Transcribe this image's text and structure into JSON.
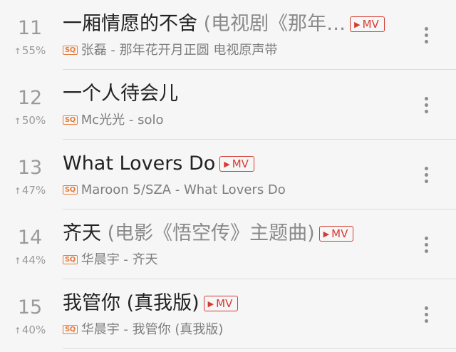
{
  "songs": [
    {
      "rank": "11",
      "trend": "55%",
      "title": "一厢情愿的不舍",
      "alias": " (电视剧《那年…",
      "has_mv": true,
      "subtitle": "张磊 - 那年花开月正圆 电视原声带"
    },
    {
      "rank": "12",
      "trend": "50%",
      "title": "一个人待会儿",
      "alias": "",
      "has_mv": false,
      "subtitle": "Mc光光 - solo"
    },
    {
      "rank": "13",
      "trend": "47%",
      "title": "What Lovers Do",
      "alias": "",
      "has_mv": true,
      "subtitle": "Maroon 5/SZA - What Lovers Do"
    },
    {
      "rank": "14",
      "trend": "44%",
      "title": "齐天",
      "alias": " (电影《悟空传》主题曲)",
      "has_mv": true,
      "subtitle": "华晨宇 - 齐天"
    },
    {
      "rank": "15",
      "trend": "40%",
      "title": "我管你 (真我版)",
      "alias": "",
      "has_mv": true,
      "subtitle": "华晨宇 - 我管你 (真我版)"
    }
  ],
  "labels": {
    "mv": "MV",
    "sq": "SQ",
    "trend_arrow": "↑",
    "mv_triangle": "▶"
  },
  "icons": {
    "more": "more-vertical-icon",
    "sq": "sq-quality-icon",
    "mv": "mv-icon"
  },
  "colors": {
    "accent": "#d43c33",
    "sq": "#e57d3c"
  }
}
